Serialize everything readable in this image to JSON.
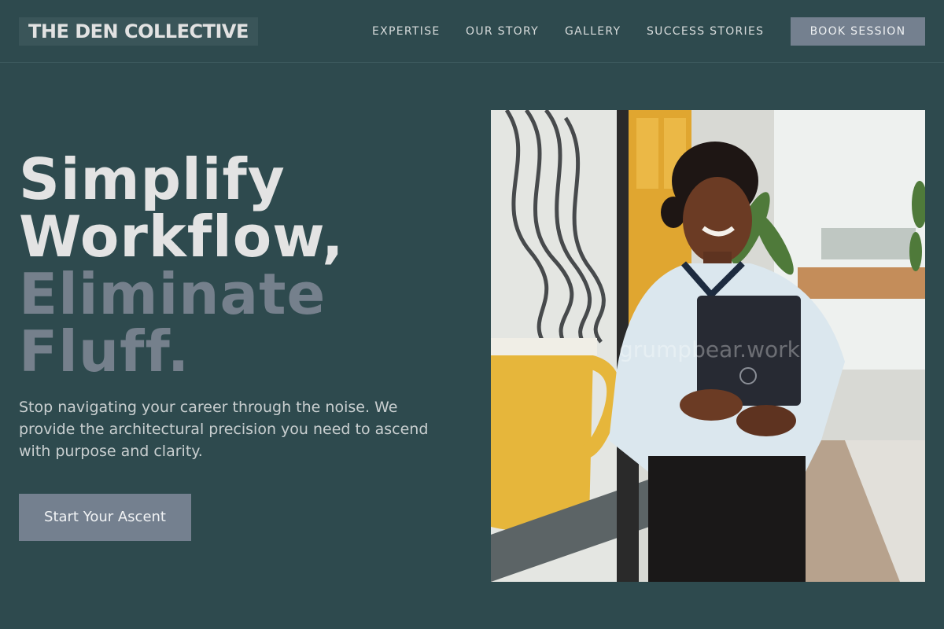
{
  "header": {
    "logo": "THE DEN COLLECTIVE",
    "nav": [
      "EXPERTISE",
      "OUR STORY",
      "GALLERY",
      "SUCCESS STORIES"
    ],
    "cta": "BOOK SESSION"
  },
  "hero": {
    "headline_line1": "Simplify",
    "headline_line2": "Workflow,",
    "headline_line3": "Eliminate",
    "headline_line4": "Fluff.",
    "subtext": "Stop navigating your career through the noise. We provide the architectural precision you need to ascend with purpose and clarity.",
    "cta": "Start Your Ascent",
    "image_watermark": "grumpbear.work"
  },
  "colors": {
    "background": "#2e4a4e",
    "accent_button": "#74808f",
    "headline_light": "#e3e3e3",
    "headline_muted": "#75808c"
  }
}
